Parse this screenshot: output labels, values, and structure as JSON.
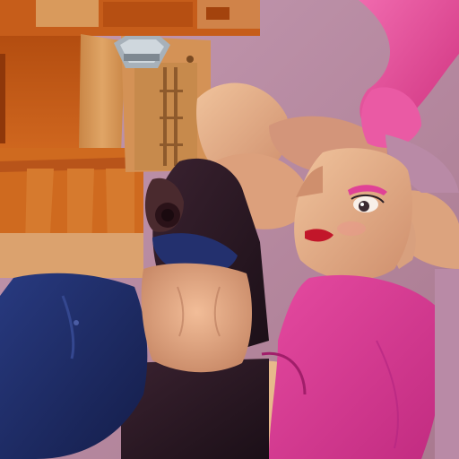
{
  "texture_atlas": {
    "palette": {
      "background_lavender": "#b98aa6",
      "leather_orange": "#c25a16",
      "leather_tan": "#d39153",
      "skin_light": "#e8b78e",
      "skin_mid": "#d79a77",
      "hair_pink": "#e84f9a",
      "shirt_magenta": "#d93a92",
      "denim_navy": "#1d2a63",
      "pants_dark": "#2a1722",
      "hat_gray": "#a9b3bb",
      "lip_red": "#c2162a"
    },
    "regions": [
      "leather-vest-panel",
      "leather-skirt-panel",
      "backpack-strap-panel",
      "metal-buckle",
      "pink-hair-swath",
      "face-panel",
      "navy-jacket-panel",
      "bare-torso-panel",
      "dark-pants-panel",
      "magenta-shirt-panel",
      "arm-skin-panels"
    ]
  }
}
